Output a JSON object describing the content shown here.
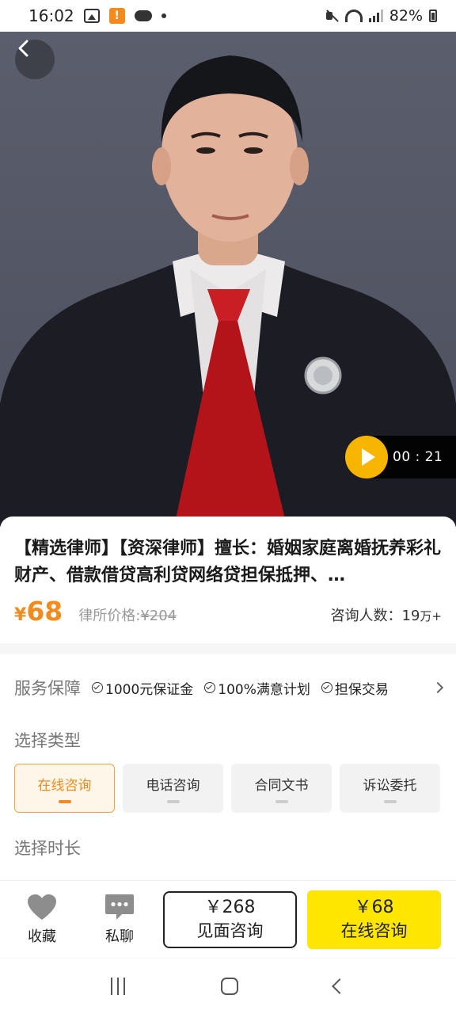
{
  "status_bar": {
    "time": "16:02",
    "battery": "82%"
  },
  "hero": {
    "video_duration": "00 : 21"
  },
  "product": {
    "title": "【精选律师】【资深律师】擅长：婚姻家庭离婚抚养彩礼财产、借款借贷高利贷网络贷担保抵押、…",
    "price_symbol": "¥",
    "price_value": "68",
    "original_price_label": "律所价格:",
    "original_price_value": "¥204",
    "consult_label": "咨询人数：",
    "consult_number": "19",
    "consult_unit": "万+"
  },
  "service": {
    "label": "服务保障",
    "items": [
      "1000元保证金",
      "100%满意计划",
      "担保交易"
    ]
  },
  "type_section": {
    "label": "选择类型",
    "options": [
      {
        "label": "在线咨询",
        "selected": true
      },
      {
        "label": "电话咨询",
        "selected": false
      },
      {
        "label": "合同文书",
        "selected": false
      },
      {
        "label": "诉讼委托",
        "selected": false
      }
    ]
  },
  "duration_section": {
    "label": "选择时长"
  },
  "bottom_bar": {
    "favorite_label": "收藏",
    "chat_label": "私聊",
    "inperson_price": "￥268",
    "inperson_label": "见面咨询",
    "online_price": "￥68",
    "online_label": "在线咨询"
  },
  "colors": {
    "accent_orange": "#f28a1e",
    "buy_yellow": "#ffe600",
    "play_yellow": "#f7b500"
  }
}
